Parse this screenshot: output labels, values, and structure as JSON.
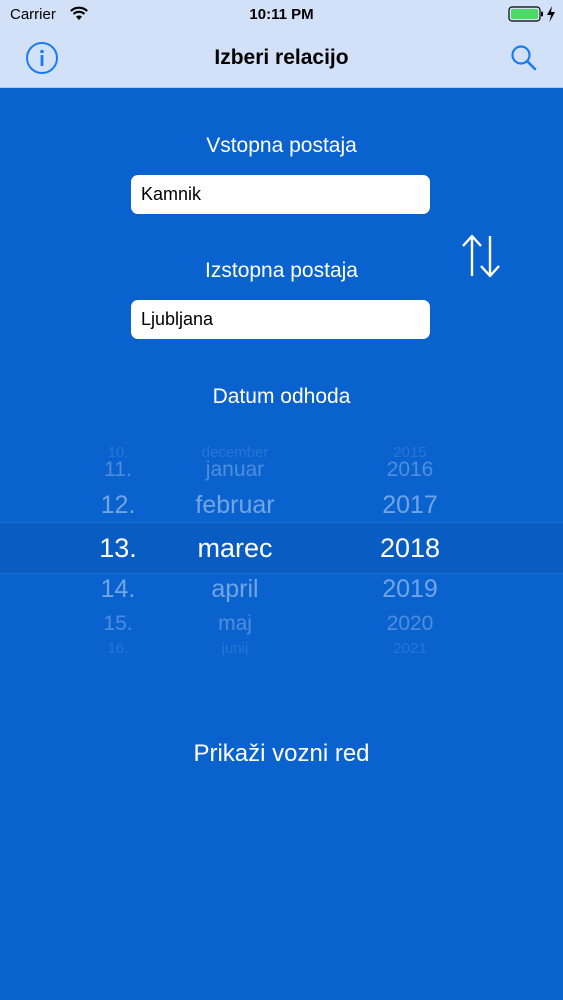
{
  "status_bar": {
    "carrier": "Carrier",
    "time": "10:11 PM"
  },
  "nav": {
    "title": "Izberi relacijo",
    "left_icon": "info-icon",
    "right_icon": "search-icon"
  },
  "form": {
    "from_label": "Vstopna postaja",
    "from_value": "Kamnik",
    "to_label": "Izstopna postaja",
    "to_value": "Ljubljana",
    "swap_icon": "swap-arrows-icon",
    "date_label": "Datum odhoda"
  },
  "date_picker": {
    "rows": [
      {
        "day": "10.",
        "month": "december",
        "year": "2015"
      },
      {
        "day": "11.",
        "month": "januar",
        "year": "2016"
      },
      {
        "day": "12.",
        "month": "februar",
        "year": "2017"
      },
      {
        "day": "13.",
        "month": "marec",
        "year": "2018"
      },
      {
        "day": "14.",
        "month": "april",
        "year": "2019"
      },
      {
        "day": "15.",
        "month": "maj",
        "year": "2020"
      },
      {
        "day": "16.",
        "month": "junij",
        "year": "2021"
      }
    ],
    "selected_index": 3
  },
  "action": {
    "label": "Prikaži vozni red"
  },
  "colors": {
    "background": "#0a62cf",
    "bar": "#d2e1f7",
    "tint": "#1a7cf5"
  }
}
